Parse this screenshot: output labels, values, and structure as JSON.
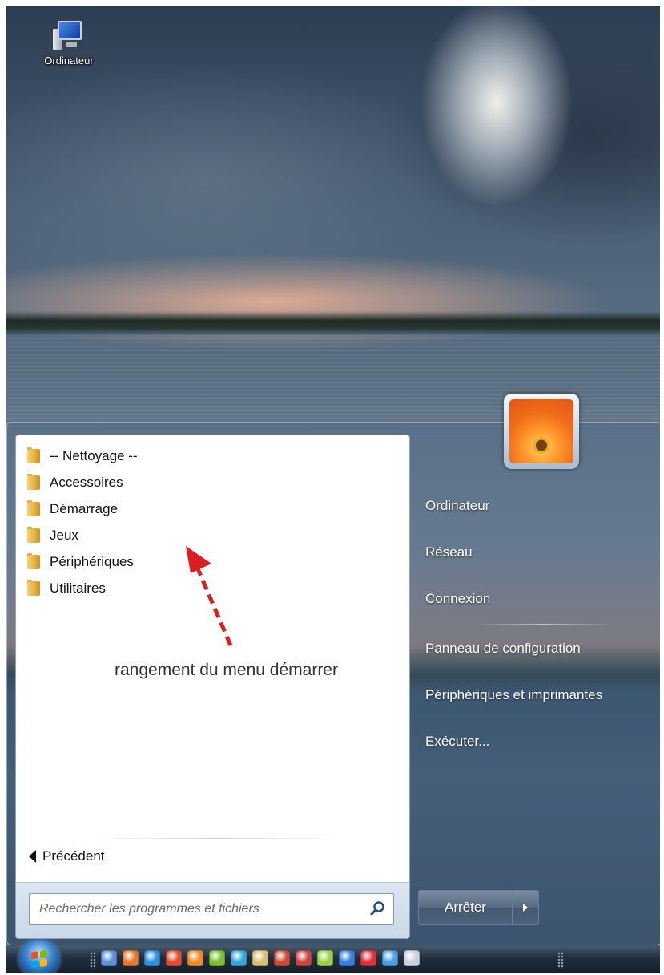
{
  "desktop": {
    "icon_label": "Ordinateur"
  },
  "start_menu": {
    "programs": [
      {
        "label": "-- Nettoyage --",
        "icon": "folder-icon"
      },
      {
        "label": "Accessoires",
        "icon": "folder-icon"
      },
      {
        "label": "Démarrage",
        "icon": "folder-icon"
      },
      {
        "label": "Jeux",
        "icon": "folder-icon"
      },
      {
        "label": "Périphériques",
        "icon": "folder-icon"
      },
      {
        "label": "Utilitaires",
        "icon": "folder-icon"
      }
    ],
    "annotation": "rangement du menu démarrer",
    "back_label": "Précédent",
    "search": {
      "placeholder": "Rechercher les programmes et fichiers"
    },
    "right_links": [
      "Ordinateur",
      "Réseau",
      "Connexion",
      "Panneau de configuration",
      "Périphériques et imprimantes",
      "Exécuter..."
    ],
    "shutdown_label": "Arrêter"
  },
  "taskbar": {
    "pinned": [
      {
        "icon": "network-icon",
        "color": "#5b8fd6"
      },
      {
        "icon": "firefox-icon",
        "color": "#e8772a"
      },
      {
        "icon": "internet-explorer-icon",
        "color": "#2f8fe0"
      },
      {
        "icon": "chrome-icon",
        "color": "#e44b2f"
      },
      {
        "icon": "mail-icon",
        "color": "#f08a24"
      },
      {
        "icon": "leaf-icon",
        "color": "#7bbf2e"
      },
      {
        "icon": "cube-icon",
        "color": "#3aa6d8"
      },
      {
        "icon": "wand-icon",
        "color": "#d8c070"
      },
      {
        "icon": "ftp-icon",
        "color": "#c84b3a"
      },
      {
        "icon": "tools-icon",
        "color": "#d0453a"
      },
      {
        "icon": "notes-icon",
        "color": "#9bd04a"
      },
      {
        "icon": "app-icon",
        "color": "#3b7fd8"
      },
      {
        "icon": "r-icon",
        "color": "#e0303a"
      },
      {
        "icon": "grid-icon",
        "color": "#4aa0e0"
      },
      {
        "icon": "console-icon",
        "color": "#c9d3dd"
      }
    ]
  },
  "colors": {
    "annotation_arrow": "#dd1e1e",
    "start_orb_flag": [
      "#f25022",
      "#7fba00",
      "#00a4ef",
      "#ffb900"
    ]
  }
}
